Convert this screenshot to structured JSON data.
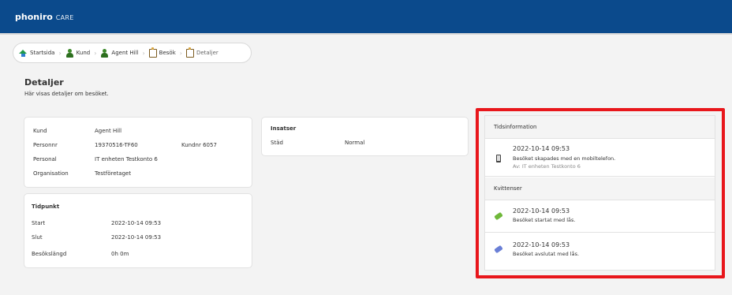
{
  "header": {
    "logo_main": "phoniro",
    "logo_sub": "CARE"
  },
  "breadcrumb": [
    {
      "label": "Startsida",
      "icon": "home-icon"
    },
    {
      "label": "Kund",
      "icon": "person-icon"
    },
    {
      "label": "Agent Hill",
      "icon": "person-icon"
    },
    {
      "label": "Besök",
      "icon": "clipboard-icon"
    },
    {
      "label": "Detaljer",
      "icon": "clipboard-icon"
    }
  ],
  "page": {
    "title": "Detaljer",
    "subtitle": "Här visas detaljer om besöket."
  },
  "kund": {
    "rows": [
      {
        "label": "Kund",
        "value": "Agent Hill"
      },
      {
        "label": "Personnr",
        "value": "19370516-TF60",
        "extra": "Kundnr 6057"
      },
      {
        "label": "Personal",
        "value": "IT enheten Testkonto 6"
      },
      {
        "label": "Organisation",
        "value": "Testföretaget"
      }
    ]
  },
  "tidpunkt": {
    "heading": "Tidpunkt",
    "rows": [
      {
        "label": "Start",
        "value": "2022-10-14  09:53"
      },
      {
        "label": "Slut",
        "value": "2022-10-14  09:53"
      },
      {
        "label": "Besökslängd",
        "value": "0h 0m"
      }
    ]
  },
  "insatser": {
    "heading": "Insatser",
    "rows": [
      {
        "label": "Städ",
        "value": "Normal"
      }
    ]
  },
  "tidsinformation": {
    "heading": "Tidsinformation",
    "items": [
      {
        "time": "2022-10-14 09:53",
        "desc": "Besöket skapades med en mobiltelefon.",
        "sub": "Av: IT enheten Testkonto 6",
        "icon": "mobile-phone-icon"
      }
    ]
  },
  "kvittenser": {
    "heading": "Kvittenser",
    "items": [
      {
        "time": "2022-10-14 09:53",
        "desc": "Besöket startat med lås.",
        "icon": "green-tag-icon"
      },
      {
        "time": "2022-10-14 09:53",
        "desc": "Besöket avslutat med lås.",
        "icon": "blue-tag-icon"
      }
    ]
  },
  "colors": {
    "header": "#0b4a8c",
    "highlight": "#e8161b",
    "background": "#f3f3f3"
  }
}
